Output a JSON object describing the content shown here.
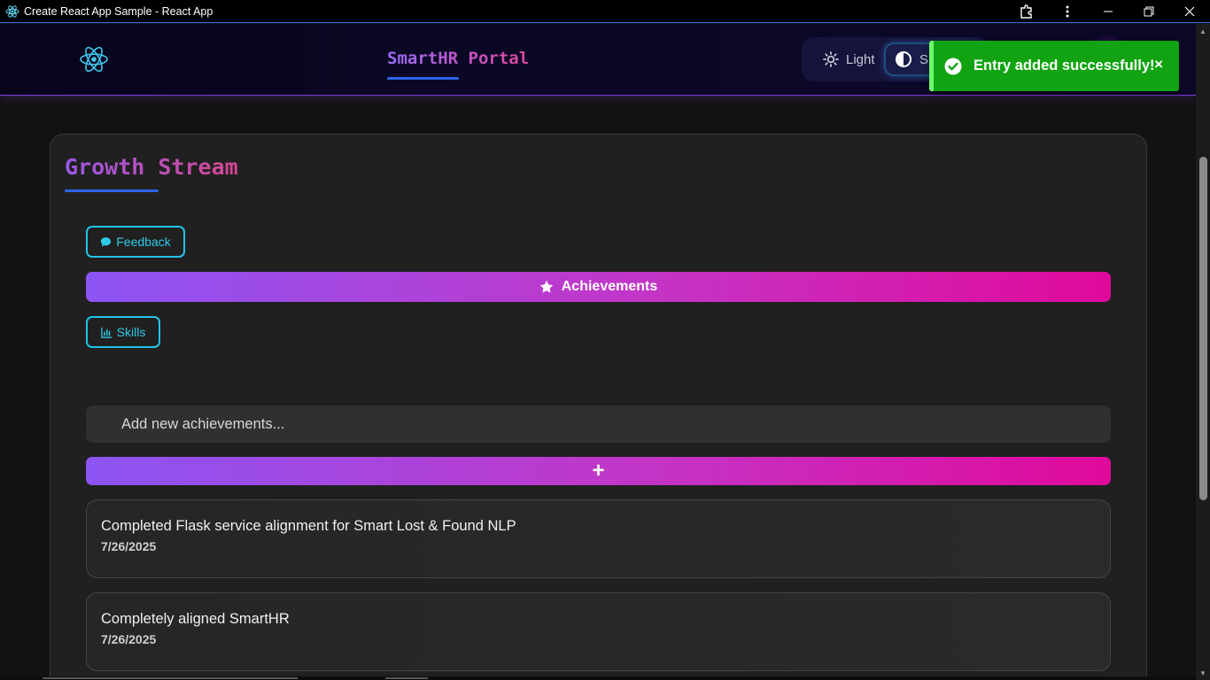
{
  "window": {
    "title": "Create React App Sample - React App"
  },
  "header": {
    "brand": "SmartHR Portal",
    "theme": {
      "light_label": "Light",
      "system_label": "S"
    }
  },
  "toast": {
    "message": "Entry added successfully!",
    "close": "×",
    "color": "#11a311"
  },
  "section": {
    "title": "Growth Stream",
    "tabs": {
      "feedback": "Feedback",
      "achievements": "Achievements",
      "skills": "Skills"
    },
    "input_placeholder": "Add new achievements...",
    "add_label": "+",
    "entries": [
      {
        "text": "Completed Flask service alignment for Smart Lost & Found NLP",
        "date": "7/26/2025"
      },
      {
        "text": "Completely aligned SmartHR",
        "date": "7/26/2025"
      }
    ]
  },
  "colors": {
    "accent_gradient_start": "#8c55f4",
    "accent_gradient_end": "#e0099c",
    "tab_outline": "#22c3e6",
    "underline": "#2b64e8"
  }
}
